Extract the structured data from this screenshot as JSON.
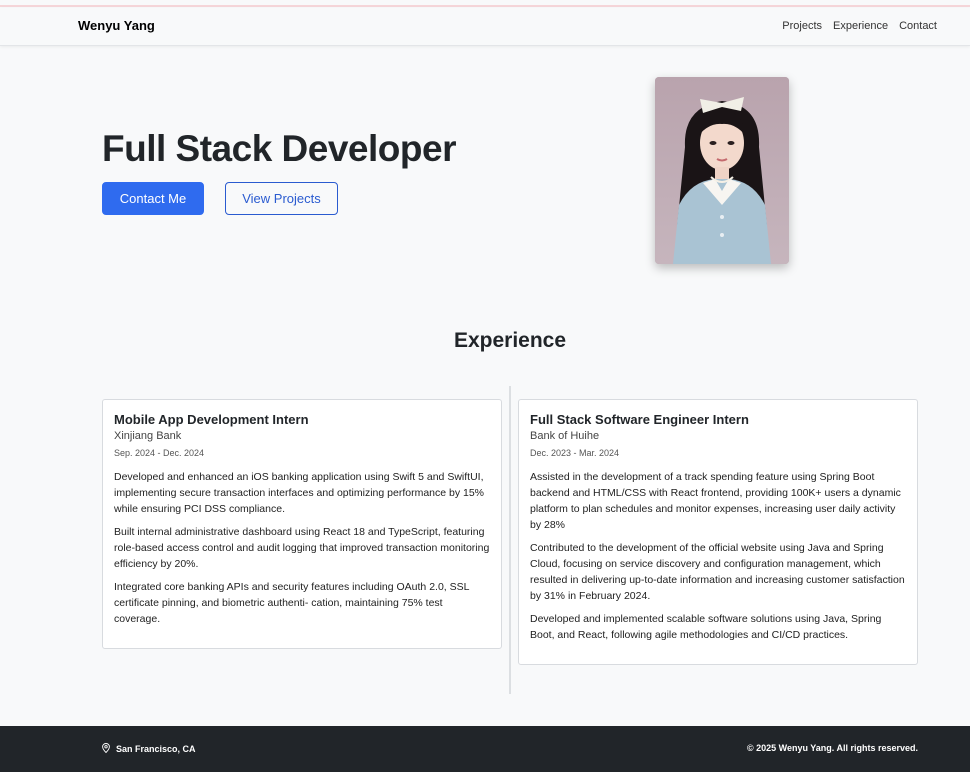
{
  "nav": {
    "brand": "Wenyu Yang",
    "links": [
      "Projects",
      "Experience",
      "Contact"
    ]
  },
  "hero": {
    "title": "Full Stack Developer",
    "primary_button": "Contact Me",
    "secondary_button": "View Projects"
  },
  "experience": {
    "title": "Experience",
    "items": [
      {
        "role": "Mobile App Development Intern",
        "company": "Xinjiang Bank",
        "dates": "Sep. 2024 - Dec. 2024",
        "bullets": [
          "Developed and enhanced an iOS banking application using Swift 5 and SwiftUI, implementing secure transaction interfaces and optimizing performance by 15% while ensuring PCI DSS compliance.",
          "Built internal administrative dashboard using React 18 and TypeScript, featuring role-based access control and audit logging that improved transaction monitoring efficiency by 20%.",
          "Integrated core banking APIs and security features including OAuth 2.0, SSL certificate pinning, and biometric authenti- cation, maintaining 75% test coverage."
        ]
      },
      {
        "role": "Full Stack Software Engineer Intern",
        "company": "Bank of Huihe",
        "dates": "Dec. 2023 - Mar. 2024",
        "bullets": [
          "Assisted in the development of a track spending feature using Spring Boot backend and HTML/CSS with React frontend, providing 100K+ users a dynamic platform to plan schedules and monitor expenses, increasing user daily activity by 28%",
          "Contributed to the development of the official website using Java and Spring Cloud, focusing on service discovery and configuration management, which resulted in delivering up-to-date information and increasing customer satisfaction by 31% in February 2024.",
          "Developed and implemented scalable software solutions using Java, Spring Boot, and React, following agile methodologies and CI/CD practices."
        ]
      }
    ]
  },
  "footer": {
    "location": "San Francisco, CA",
    "location_icon": "map-pin-icon",
    "copyright": "© 2025 Wenyu Yang. All rights reserved."
  },
  "colors": {
    "primary": "#2f6bef",
    "footer_bg": "#212529",
    "page_bg": "#f8f9fa"
  }
}
